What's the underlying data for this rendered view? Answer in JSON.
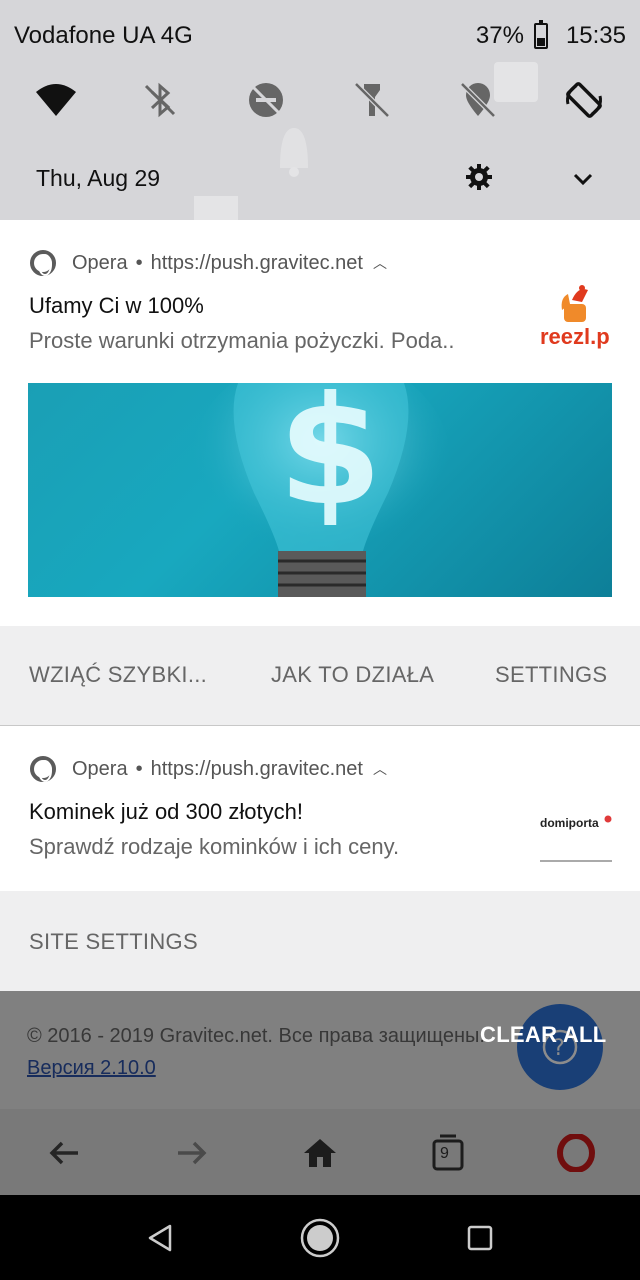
{
  "status_bar": {
    "carrier": "Vodafone UA 4G",
    "battery": "37%",
    "battery_level": 0.37,
    "time": "15:35"
  },
  "quick_settings": {
    "tiles": [
      {
        "icon": "wifi-icon",
        "active": true
      },
      {
        "icon": "bluetooth-off-icon",
        "active": false
      },
      {
        "icon": "dnd-off-icon",
        "active": false
      },
      {
        "icon": "flashlight-off-icon",
        "active": false
      },
      {
        "icon": "location-off-icon",
        "active": false
      },
      {
        "icon": "auto-rotate-icon",
        "active": true
      }
    ],
    "date": "Thu, Aug 29"
  },
  "notifications": [
    {
      "app": "Opera",
      "source": "https://push.gravitec.net",
      "title": "Ufamy Ci w 100%",
      "body": "Proste warunki otrzymania pożyczki. Poda..",
      "logo_text": "reezl.p",
      "actions": [
        "WZIĄĆ SZYBKI...",
        "JAK TO DZIAŁA",
        "SETTINGS"
      ]
    },
    {
      "app": "Opera",
      "source": "https://push.gravitec.net",
      "title": "Kominek już od 300 złotych!",
      "body": "Sprawdź rodzaje kominków i ich ceny.",
      "logo_text": "domiporta",
      "actions": [
        "SITE SETTINGS"
      ]
    }
  ],
  "background_page": {
    "footer": "© 2016 - 2019 Gravitec.net. Все права защищены.",
    "version": "Версия 2.10.0",
    "tab_count": "9"
  },
  "clear_all": "CLEAR ALL",
  "colors": {
    "shade": "#d6d6d9",
    "action_bg": "#efeff0",
    "reezl_red": "#e03a1e",
    "link": "#2b50a8",
    "opera_red": "#cc1b1b"
  }
}
